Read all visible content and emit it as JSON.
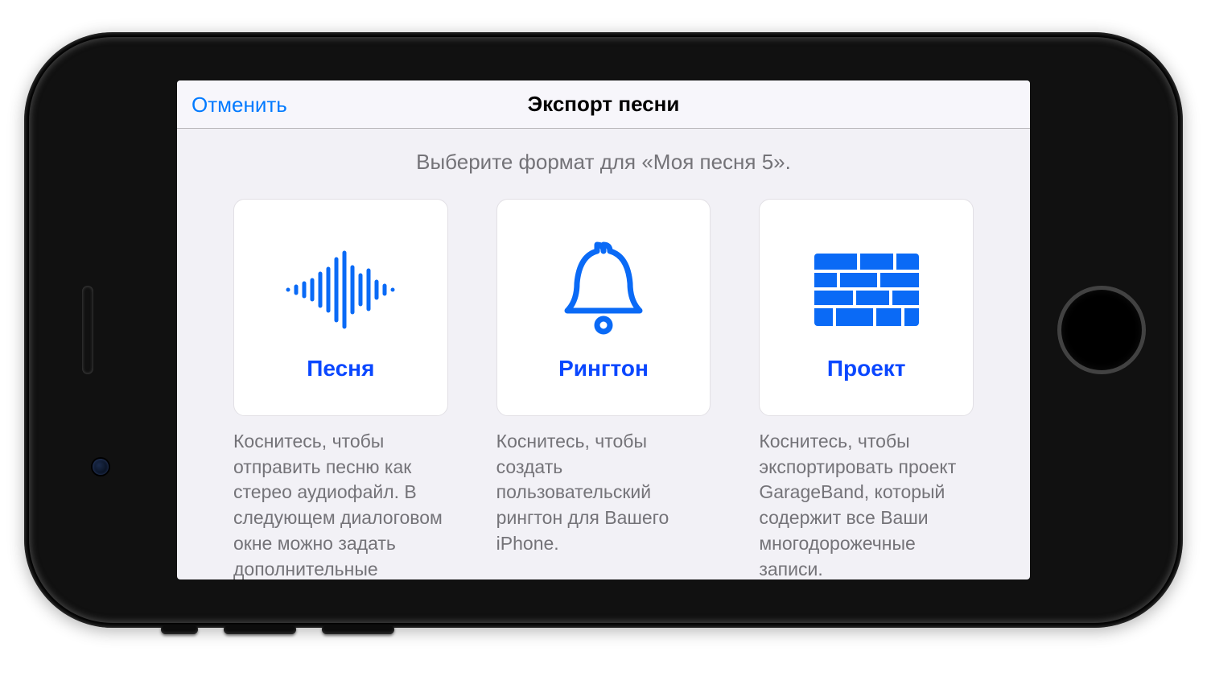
{
  "navbar": {
    "cancel": "Отменить",
    "title": "Экспорт песни"
  },
  "subtitle": "Выберите формат для «Моя песня 5».",
  "options": {
    "song": {
      "label": "Песня",
      "desc": "Коснитесь, чтобы отправить песню как стерео аудиофайл. В следующем диалоговом окне можно задать дополнительные"
    },
    "ringtone": {
      "label": "Рингтон",
      "desc": "Коснитесь, чтобы создать пользовательский рингтон для Вашего iPhone."
    },
    "project": {
      "label": "Проект",
      "desc": "Коснитесь, чтобы экспортировать проект GarageBand, который содержит все Ваши многодорожечные записи."
    }
  },
  "colors": {
    "accent": "#007aff",
    "iconBlue": "#0a6af6"
  }
}
